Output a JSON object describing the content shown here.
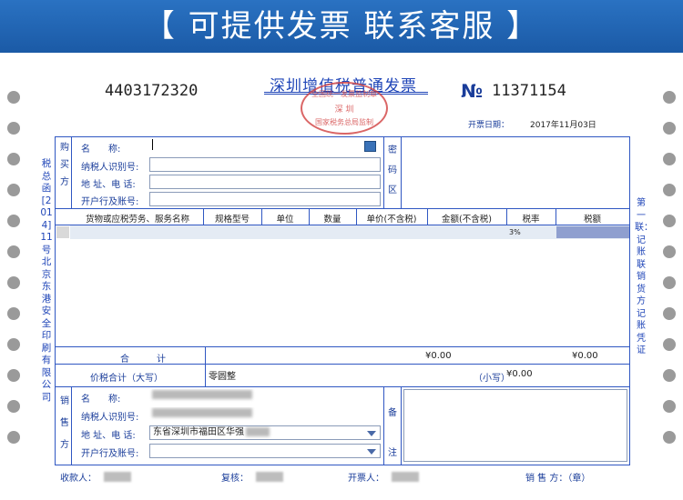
{
  "banner": {
    "text": "【 可提供发票 联系客服 】"
  },
  "header": {
    "invoice_code": "4403172320",
    "title": "深圳增值税普通发票",
    "number_mark": "№",
    "invoice_number": "11371154",
    "issue_date_label": "开票日期：",
    "issue_date": "2017年11月03日",
    "seal": {
      "line1": "全国统一发票监制章",
      "line2": "深 圳",
      "line3": "国家税务总局监制"
    }
  },
  "side_text": {
    "left": "税总函[2014]11号北京东港安全印刷有限公司",
    "right": "第一联：记账联销货方记账凭证"
  },
  "buyer": {
    "section_label": "购买方",
    "name_label": "名　　称:",
    "tax_id_label": "纳税人识别号:",
    "address_label": "地 址、电 话:",
    "bank_label": "开户行及账号:",
    "name_value": "",
    "tax_id_value": "",
    "address_value": "",
    "bank_value": ""
  },
  "cipher": {
    "label": "密码区"
  },
  "table": {
    "headers": [
      "货物或应税劳务、服务名称",
      "规格型号",
      "单位",
      "数量",
      "单价(不含税)",
      "金额(不含税)",
      "税率",
      "税额"
    ],
    "rows": [
      {
        "name": "",
        "spec": "",
        "unit": "",
        "qty": "",
        "price": "",
        "amount": "",
        "rate": "3%",
        "tax": ""
      }
    ]
  },
  "totals": {
    "label": "合　　　计",
    "amount": "¥0.00",
    "tax": "¥0.00",
    "grand_label": "价税合计（大写）",
    "grand_words": "零圆整",
    "small_label": "（小写）",
    "small_value": "¥0.00"
  },
  "seller": {
    "section_label": "销售方",
    "name_label": "名　　称:",
    "tax_id_label": "纳税人识别号:",
    "address_label": "地 址、电 话:",
    "bank_label": "开户行及账号:",
    "name_value": "",
    "tax_id_value": "",
    "address_value": "东省深圳市福田区华强",
    "bank_value": ""
  },
  "remarks": {
    "label": "备注"
  },
  "footer": {
    "payee_label": "收款人：",
    "reviewer_label": "复核：",
    "drawer_label": "开票人：",
    "seller_label": "销 售 方：（章）"
  }
}
